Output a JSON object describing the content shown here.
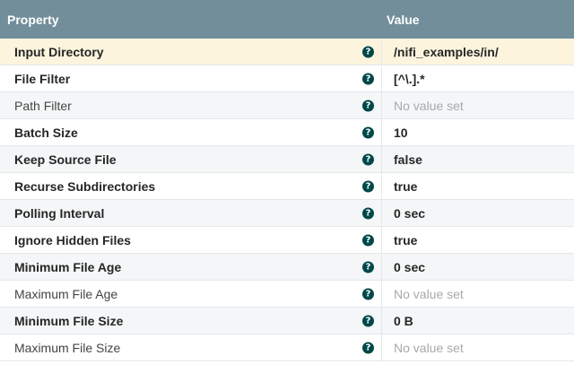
{
  "header": {
    "property": "Property",
    "value": "Value"
  },
  "help_glyph": "?",
  "rows": [
    {
      "name": "Input Directory",
      "value": "/nifi_examples/in/",
      "required": true,
      "set": true
    },
    {
      "name": "File Filter",
      "value": "[^\\.].*",
      "required": true,
      "set": true
    },
    {
      "name": "Path Filter",
      "value": "No value set",
      "required": false,
      "set": false
    },
    {
      "name": "Batch Size",
      "value": "10",
      "required": true,
      "set": true
    },
    {
      "name": "Keep Source File",
      "value": "false",
      "required": true,
      "set": true
    },
    {
      "name": "Recurse Subdirectories",
      "value": "true",
      "required": true,
      "set": true
    },
    {
      "name": "Polling Interval",
      "value": "0 sec",
      "required": true,
      "set": true
    },
    {
      "name": "Ignore Hidden Files",
      "value": "true",
      "required": true,
      "set": true
    },
    {
      "name": "Minimum File Age",
      "value": "0 sec",
      "required": true,
      "set": true
    },
    {
      "name": "Maximum File Age",
      "value": "No value set",
      "required": false,
      "set": false
    },
    {
      "name": "Minimum File Size",
      "value": "0 B",
      "required": true,
      "set": true
    },
    {
      "name": "Maximum File Size",
      "value": "No value set",
      "required": false,
      "set": false
    }
  ],
  "colors": {
    "header_bg": "#728e9b",
    "selected_row": "#fcf4dd",
    "alt_row": "#f4f6f7",
    "help_icon": "#004849",
    "unset_text": "#a7a9ab"
  }
}
